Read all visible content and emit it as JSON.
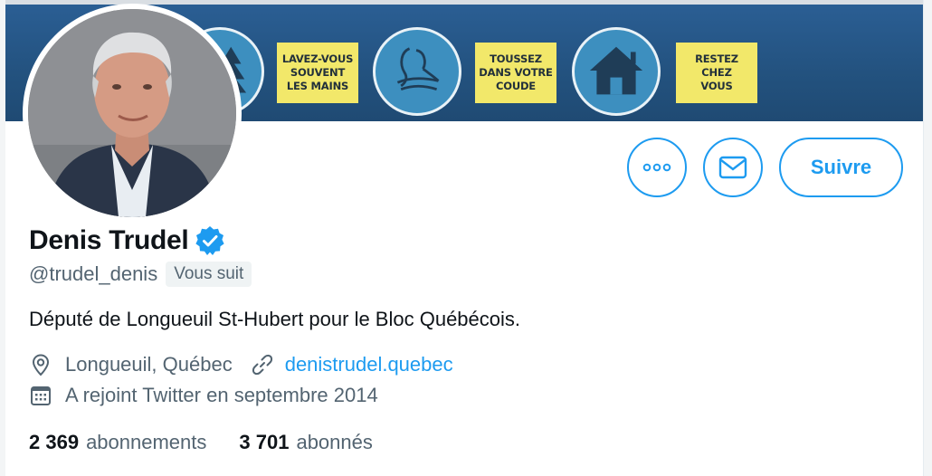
{
  "banner": {
    "signs": [
      "LAVEZ-VOUS\nSOUVENT\nLES MAINS",
      "TOUSSEZ\nDANS VOTRE\nCOUDE",
      "RESTEZ\nCHEZ\nVOUS"
    ],
    "colors": {
      "background": "#23527f",
      "circle": "#3d8fbf",
      "sign": "#f2e86a"
    }
  },
  "actions": {
    "more_icon": "more-icon",
    "mail_icon": "mail-icon",
    "follow_label": "Suivre"
  },
  "profile": {
    "name": "Denis Trudel",
    "verified_icon": "verified-badge-icon",
    "handle": "@trudel_denis",
    "follows_you": "Vous suit",
    "bio": "Député de Longueuil St-Hubert pour le Bloc Québécois.",
    "location": "Longueuil, Québec",
    "website": "denistrudel.quebec",
    "joined": "A rejoint Twitter en septembre 2014"
  },
  "stats": {
    "following_count": "2 369",
    "following_label": "abonnements",
    "followers_count": "3 701",
    "followers_label": "abonnés"
  },
  "colors": {
    "accent": "#1d9bf0",
    "secondary_text": "#536471"
  }
}
